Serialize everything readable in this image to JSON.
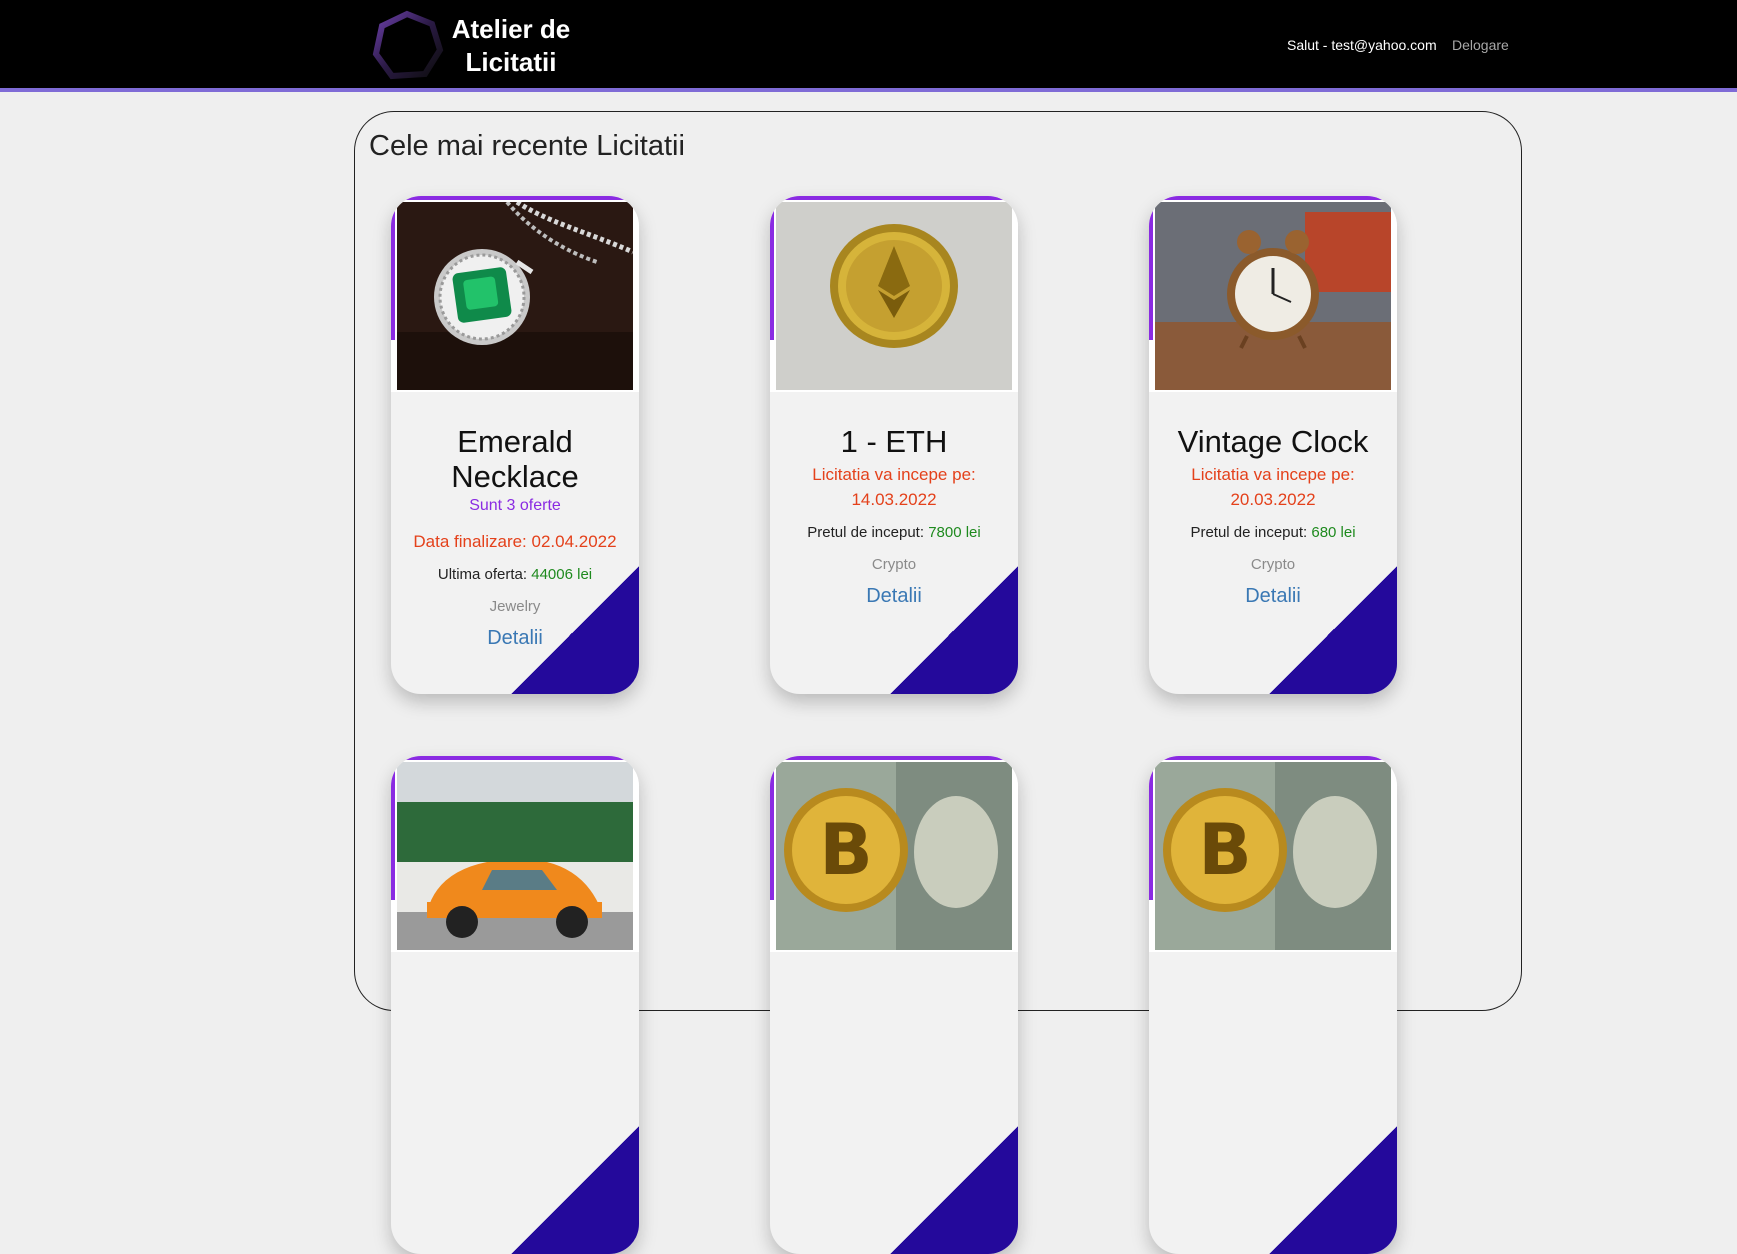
{
  "header": {
    "brand_line1": "Atelier de",
    "brand_line2": "Licitatii",
    "greeting": "Salut - test@yahoo.com",
    "logout_label": "Delogare"
  },
  "main": {
    "title": "Cele mai recente Licitatii"
  },
  "cards": [
    {
      "title": "Emerald Necklace",
      "offers": "Sunt 3 oferte",
      "date_text": "Data finalizare: 02.04.2022",
      "price_label": "Ultima oferta:",
      "price_value": "44006 lei",
      "category": "Jewelry",
      "details_label": "Detalii",
      "image": "emerald-necklace"
    },
    {
      "title": "1 - ETH",
      "date_line1": "Licitatia va incepe pe:",
      "date_line2": "14.03.2022",
      "price_label": "Pretul de inceput:",
      "price_value": "7800 lei",
      "category": "Crypto",
      "details_label": "Detalii",
      "image": "ethereum-coin"
    },
    {
      "title": "Vintage Clock",
      "date_line1": "Licitatia va incepe pe:",
      "date_line2": "20.03.2022",
      "price_label": "Pretul de inceput:",
      "price_value": "680 lei",
      "category": "Crypto",
      "details_label": "Detalii",
      "image": "alarm-clock"
    },
    {
      "image": "orange-beetle-car"
    },
    {
      "image": "bitcoin-dollar"
    },
    {
      "image": "bitcoin-dollar"
    }
  ],
  "colors": {
    "accent_purple": "#8a2be2",
    "corner_navy": "#24099b",
    "date_red": "#e4411b",
    "price_green": "#1e8a1e",
    "link_blue": "#3a78b4",
    "header_line": "#7f6bd6"
  }
}
